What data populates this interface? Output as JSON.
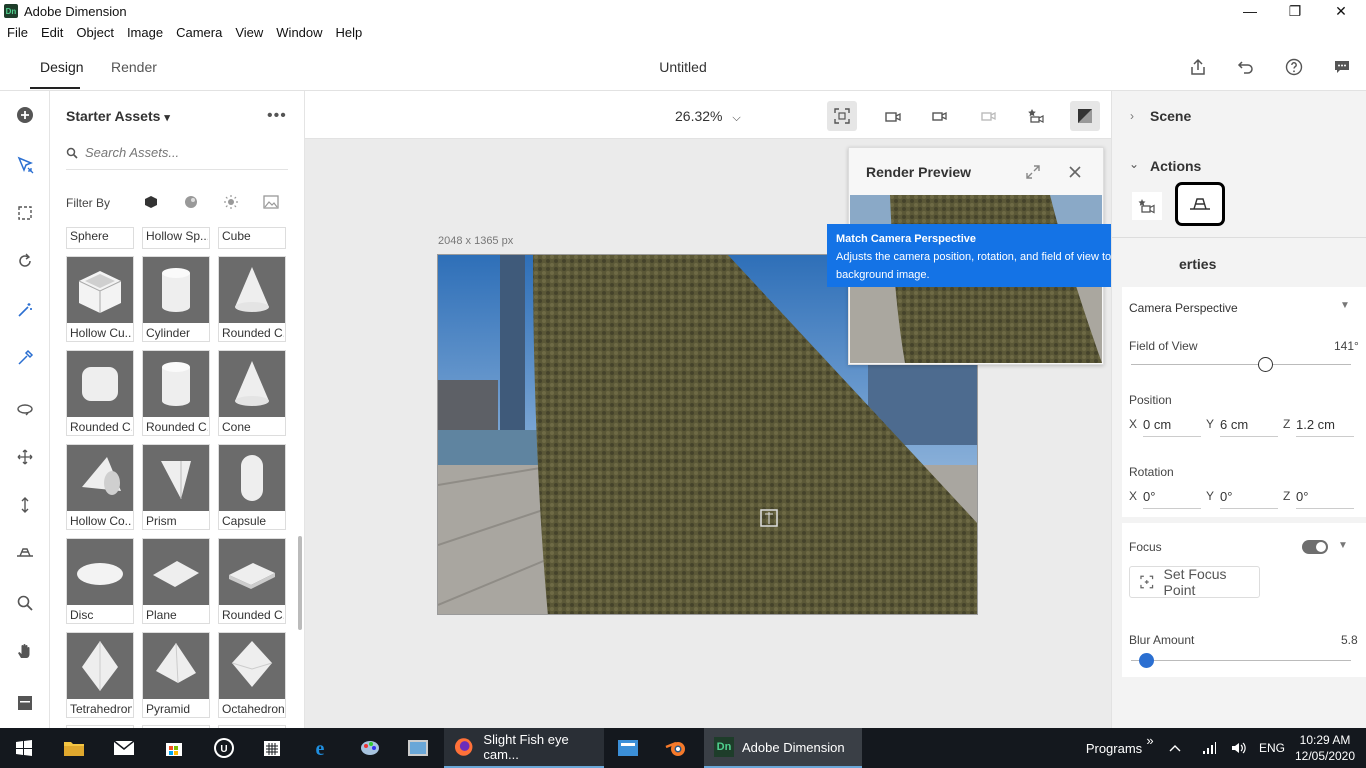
{
  "window": {
    "app_icon": "Dn",
    "title": "Adobe Dimension",
    "minimize": "—",
    "restore": "❐",
    "close": "✕"
  },
  "menu": [
    "File",
    "Edit",
    "Object",
    "Image",
    "Camera",
    "View",
    "Window",
    "Help"
  ],
  "tabs": {
    "design": "Design",
    "render": "Render"
  },
  "document_title": "Untitled",
  "assets": {
    "title": "Starter Assets",
    "search_placeholder": "Search Assets...",
    "filter_by": "Filter By",
    "items": [
      {
        "label": "Sphere",
        "shape": "sphere"
      },
      {
        "label": "Hollow Sp...",
        "shape": "sphere"
      },
      {
        "label": "Cube",
        "shape": "cube"
      },
      {
        "label": "Hollow Cu...",
        "shape": "hollowcube"
      },
      {
        "label": "Cylinder",
        "shape": "cylinder"
      },
      {
        "label": "Rounded C...",
        "shape": "cone"
      },
      {
        "label": "Rounded C...",
        "shape": "roundcube"
      },
      {
        "label": "Rounded C...",
        "shape": "cylinder"
      },
      {
        "label": "Cone",
        "shape": "cone"
      },
      {
        "label": "Hollow Co...",
        "shape": "hollowcone"
      },
      {
        "label": "Prism",
        "shape": "prism"
      },
      {
        "label": "Capsule",
        "shape": "capsule"
      },
      {
        "label": "Disc",
        "shape": "disc"
      },
      {
        "label": "Plane",
        "shape": "plane"
      },
      {
        "label": "Rounded C...",
        "shape": "roundplane"
      },
      {
        "label": "Tetrahedron",
        "shape": "tetra"
      },
      {
        "label": "Pyramid",
        "shape": "pyramid"
      },
      {
        "label": "Octahedron",
        "shape": "octa"
      }
    ]
  },
  "canvas": {
    "zoom": "26.32%",
    "image_size": "2048 x 1365 px"
  },
  "render_preview": {
    "title": "Render Preview"
  },
  "tooltip": {
    "title": "Match Camera Perspective",
    "body": "Adjusts the camera position, rotation, and field of view to match the background image."
  },
  "panel": {
    "scene": "Scene",
    "actions": "Actions",
    "properties_partial": "erties",
    "camera_mode": "Camera Perspective",
    "fov_label": "Field of View",
    "fov_value": "141°",
    "fov_fraction": 0.61,
    "position_label": "Position",
    "position": {
      "x": "0 cm",
      "y": "6 cm",
      "z": "1.2 cm"
    },
    "rotation_label": "Rotation",
    "rotation": {
      "x": "0°",
      "y": "0°",
      "z": "0°"
    },
    "axis": {
      "x": "X",
      "y": "Y",
      "z": "Z"
    },
    "focus_label": "Focus",
    "focus_on": true,
    "set_focus": "Set Focus Point",
    "blur_label": "Blur Amount",
    "blur_value": "5.8",
    "blur_fraction": 0.07
  },
  "taskbar": {
    "active_app": "Adobe Dimension",
    "firefox_window": "Slight Fish eye cam...",
    "programs": "Programs",
    "expand": "»",
    "language": "ENG",
    "time": "10:29 AM",
    "date": "12/05/2020"
  },
  "colors": {
    "accent": "#2b6fd1",
    "tooltip": "#1473e6",
    "taskbar": "#14181e",
    "dn_green": "#4fd18e"
  }
}
